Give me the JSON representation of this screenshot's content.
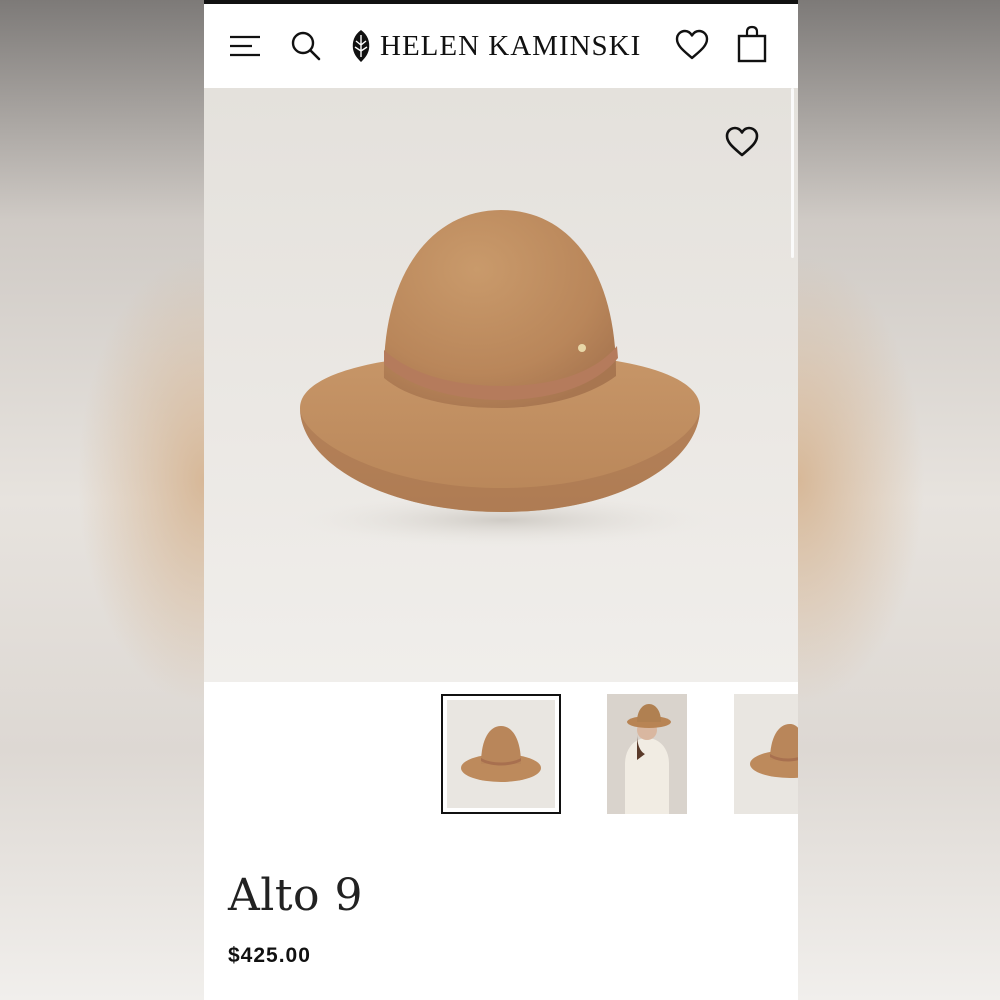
{
  "brand": {
    "name": "HELEN KAMINSKI"
  },
  "header": {
    "menu_icon": "hamburger-menu-icon",
    "search_icon": "search-icon",
    "wishlist_icon": "heart-icon",
    "bag_icon": "shopping-bag-icon"
  },
  "product": {
    "name": "Alto 9",
    "price": "$425.00",
    "colors": {
      "hat": "#c08e5f",
      "band": "#b47a5b",
      "accent": "#111111"
    }
  },
  "gallery": {
    "thumbnails": [
      "hat-front",
      "model-wearing-hat",
      "hat-side"
    ],
    "selected_index": 0
  }
}
